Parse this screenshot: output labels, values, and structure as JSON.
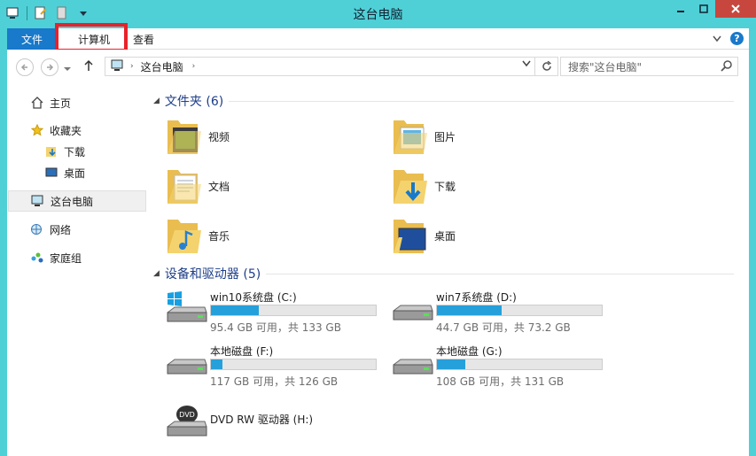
{
  "window": {
    "title": "这台电脑"
  },
  "ribbon": {
    "tabs": [
      {
        "label": "文件"
      },
      {
        "label": "计算机"
      },
      {
        "label": "查看"
      }
    ]
  },
  "address": {
    "crumb": "这台电脑"
  },
  "search": {
    "placeholder": "搜索\"这台电脑\""
  },
  "sidebar": {
    "items": [
      {
        "label": "主页"
      },
      {
        "label": "收藏夹"
      },
      {
        "label": "下载"
      },
      {
        "label": "桌面"
      },
      {
        "label": "这台电脑"
      },
      {
        "label": "网络"
      },
      {
        "label": "家庭组"
      }
    ]
  },
  "folders_group": {
    "title": "文件夹 (6)"
  },
  "folders": [
    {
      "label": "视频"
    },
    {
      "label": "图片"
    },
    {
      "label": "文档"
    },
    {
      "label": "下载"
    },
    {
      "label": "音乐"
    },
    {
      "label": "桌面"
    }
  ],
  "devices_group": {
    "title": "设备和驱动器 (5)"
  },
  "drives": [
    {
      "name": "win10系统盘 (C:)",
      "free": "95.4 GB 可用，共 133 GB",
      "used_fraction": 0.29
    },
    {
      "name": "win7系统盘 (D:)",
      "free": "44.7 GB 可用，共 73.2 GB",
      "used_fraction": 0.39
    },
    {
      "name": "本地磁盘 (F:)",
      "free": "117 GB 可用，共 126 GB",
      "used_fraction": 0.07
    },
    {
      "name": "本地磁盘 (G:)",
      "free": "108 GB 可用，共 131 GB",
      "used_fraction": 0.17
    },
    {
      "name": "DVD RW 驱动器 (H:)"
    }
  ],
  "colors": {
    "accent": "#1979ca",
    "titlebar": "#4fd0d6",
    "highlight": "#e8222a",
    "bar_fill": "#26a0da"
  }
}
